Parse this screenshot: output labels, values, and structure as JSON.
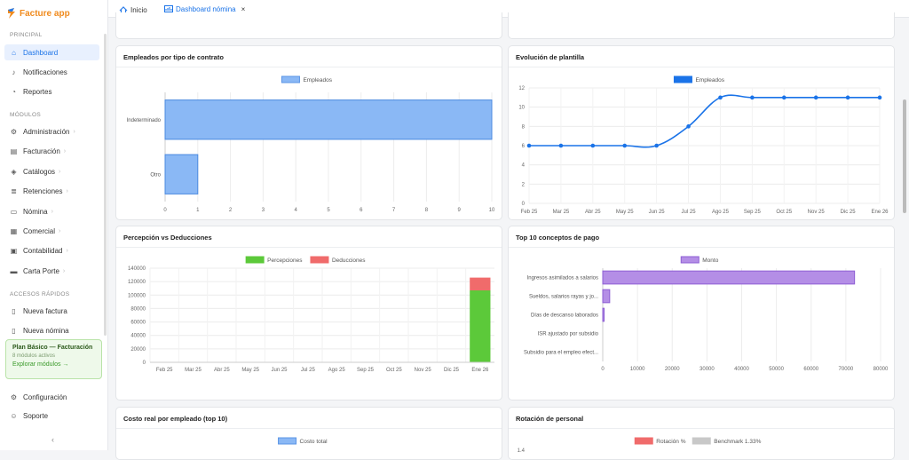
{
  "app": {
    "name": "Facture app"
  },
  "sidebar": {
    "sections": {
      "principal": "PRINCIPAL",
      "modulos": "MÓDULOS",
      "accesos": "ACCESOS RÁPIDOS"
    },
    "items": [
      {
        "label": "Dashboard",
        "icon": "dashboard-icon"
      },
      {
        "label": "Notificaciones",
        "icon": "bell-icon"
      },
      {
        "label": "Reportes",
        "icon": "report-icon"
      },
      {
        "label": "Administración",
        "icon": "gears-icon"
      },
      {
        "label": "Facturación",
        "icon": "invoice-icon"
      },
      {
        "label": "Catálogos",
        "icon": "layers-icon"
      },
      {
        "label": "Retenciones",
        "icon": "stack-icon"
      },
      {
        "label": "Nómina",
        "icon": "payroll-icon"
      },
      {
        "label": "Comercial",
        "icon": "shop-icon"
      },
      {
        "label": "Contabilidad",
        "icon": "ledger-icon"
      },
      {
        "label": "Carta Porte",
        "icon": "truck-icon"
      },
      {
        "label": "Nueva factura",
        "icon": "doc-icon"
      },
      {
        "label": "Nueva nómina",
        "icon": "doc-icon"
      },
      {
        "label": "Configuración",
        "icon": "gear-icon"
      },
      {
        "label": "Soporte",
        "icon": "support-icon"
      }
    ],
    "plan": {
      "title": "Plan Básico — Facturación",
      "subtitle": "8 módulos activos",
      "link": "Explorar módulos →"
    },
    "collapse": "‹"
  },
  "tabs": [
    {
      "label": "Inicio",
      "icon": "home-icon"
    },
    {
      "label": "Dashboard nómina",
      "icon": "chart-icon",
      "close": "×"
    }
  ],
  "colors": {
    "accent": "#1a73e8",
    "blue": "#8ab8f5",
    "green": "#5cc93a",
    "red": "#f06b6b",
    "purple": "#b48ee6"
  },
  "cards": {
    "contrato": "Empleados por tipo de contrato",
    "evolucion": "Evolución de plantilla",
    "percepcion": "Percepción vs Deducciones",
    "top10": "Top 10 conceptos de pago",
    "costo": "Costo real por empleado (top 10)",
    "rotacion": "Rotación de personal"
  },
  "chart_data": [
    {
      "type": "bar",
      "orientation": "horizontal",
      "title": "Empleados por tipo de contrato",
      "categories": [
        "Indeterminado",
        "Otro"
      ],
      "series": [
        {
          "name": "Empleados",
          "values": [
            10,
            1
          ]
        }
      ],
      "xlim": [
        0,
        10
      ],
      "xticks": [
        "0",
        "1",
        "2",
        "3",
        "4",
        "5",
        "6",
        "7",
        "8",
        "9",
        "10"
      ],
      "legend": "top"
    },
    {
      "type": "line",
      "title": "Evolución de plantilla",
      "x": [
        "Feb 25",
        "Mar 25",
        "Abr 25",
        "May 25",
        "Jun 25",
        "Jul 25",
        "Ago 25",
        "Sep 25",
        "Oct 25",
        "Nov 25",
        "Dic 25",
        "Ene 26"
      ],
      "series": [
        {
          "name": "Empleados",
          "values": [
            6,
            6,
            6,
            6,
            6,
            8,
            11,
            11,
            11,
            11,
            11,
            11
          ]
        }
      ],
      "ylim": [
        0,
        12
      ],
      "yticks": [
        "0",
        "2",
        "4",
        "6",
        "8",
        "10",
        "12"
      ],
      "legend": "top"
    },
    {
      "type": "bar",
      "stacked": true,
      "title": "Percepción vs Deducciones",
      "categories": [
        "Feb 25",
        "Mar 25",
        "Abr 25",
        "May 25",
        "Jun 25",
        "Jul 25",
        "Ago 25",
        "Sep 25",
        "Oct 25",
        "Nov 25",
        "Dic 25",
        "Ene 26"
      ],
      "series": [
        {
          "name": "Percepciones",
          "values": [
            0,
            0,
            0,
            0,
            0,
            0,
            0,
            0,
            0,
            0,
            0,
            107000
          ]
        },
        {
          "name": "Deducciones",
          "values": [
            0,
            0,
            0,
            0,
            0,
            0,
            0,
            0,
            0,
            0,
            0,
            19000
          ]
        }
      ],
      "ylim": [
        0,
        140000
      ],
      "yticks": [
        "0",
        "20000",
        "40000",
        "60000",
        "80000",
        "100000",
        "120000",
        "140000"
      ],
      "legend": "top"
    },
    {
      "type": "bar",
      "orientation": "horizontal",
      "title": "Top 10 conceptos de pago",
      "categories": [
        "Ingresos asimilados a salarios",
        "Sueldos, salarios  rayas y jo...",
        "Días de descanso laborados",
        "ISR ajustado por subsidio",
        "Subsidio para el empleo efect..."
      ],
      "series": [
        {
          "name": "Monto",
          "values": [
            72500,
            2000,
            400,
            0,
            0
          ]
        }
      ],
      "xlim": [
        0,
        80000
      ],
      "xticks": [
        "0",
        "10000",
        "20000",
        "30000",
        "40000",
        "50000",
        "60000",
        "70000",
        "80000"
      ],
      "legend": "top"
    },
    {
      "type": "bar",
      "title": "Costo real por empleado (top 10)",
      "series": [
        {
          "name": "Costo total",
          "values": []
        }
      ],
      "legend": "top"
    },
    {
      "type": "line",
      "title": "Rotación de personal",
      "series": [
        {
          "name": "Rotación %",
          "values": []
        },
        {
          "name": "Benchmark 1.33%",
          "values": []
        }
      ],
      "yticks": [
        "1.4"
      ],
      "legend": "top"
    }
  ]
}
